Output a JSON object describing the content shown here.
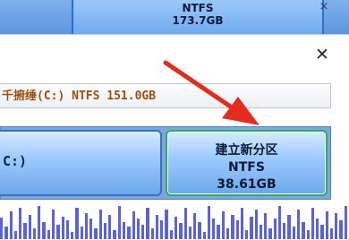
{
  "background_partition": {
    "line1": "······",
    "fs": "NTFS",
    "size": "173.7GB"
  },
  "background_close_glyph": "×",
  "dialog": {
    "close_glyph": "✕",
    "info_bar_text": "千捬缍(C:) NTFS 151.0GB",
    "partitions": [
      {
        "label": "C:)"
      },
      {
        "name": "建立新分区",
        "fs": "NTFS",
        "size": "38.61GB"
      }
    ]
  },
  "colors": {
    "accent_arrow": "#e32c1e",
    "partition_fill": "#9fccff",
    "graph_bars": "#5b63d9",
    "info_text": "#9e4d10"
  },
  "graph_bar_heights": [
    0.62,
    0.35,
    0.8,
    0.22,
    0.9,
    0.45,
    0.7,
    0.3,
    0.95,
    0.5,
    0.25,
    0.85,
    0.4,
    0.65,
    0.55,
    0.2,
    0.9,
    0.35,
    0.75,
    0.6,
    0.3,
    0.85,
    0.45,
    0.7,
    0.25,
    0.95,
    0.5,
    0.35,
    0.8,
    0.6,
    0.4,
    0.9,
    0.3,
    0.7,
    0.55,
    0.85,
    0.25,
    0.65,
    0.45,
    0.9,
    0.35,
    0.75,
    0.5,
    0.2,
    0.95,
    0.6,
    0.4,
    0.8,
    0.3,
    0.7,
    0.55,
    0.9,
    0.25,
    0.65,
    0.85,
    0.4,
    0.75,
    0.3,
    0.6,
    0.95,
    0.45,
    0.7,
    0.35,
    0.85,
    0.5,
    0.25,
    0.9,
    0.6,
    0.4,
    0.8,
    0.3,
    0.75,
    0.55,
    0.95
  ]
}
